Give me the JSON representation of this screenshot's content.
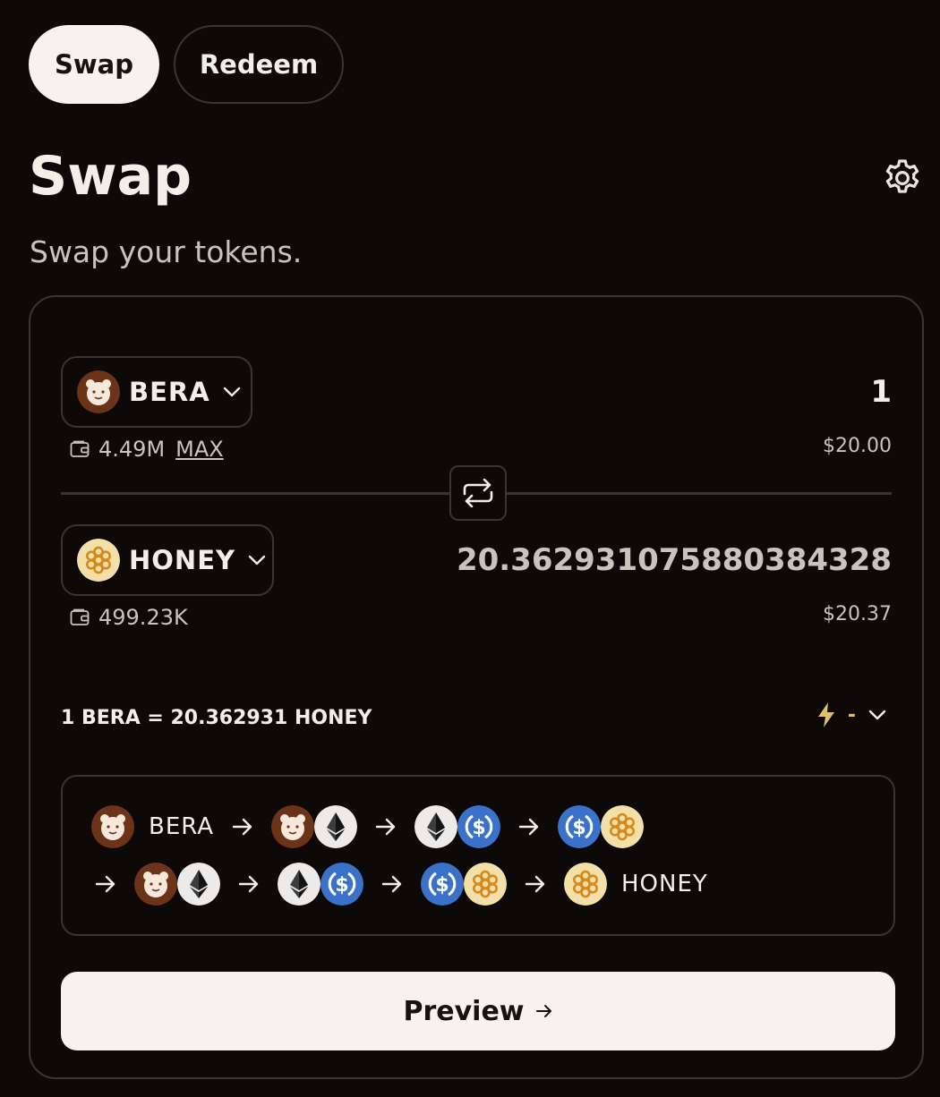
{
  "tabs": [
    {
      "label": "Swap",
      "active": true
    },
    {
      "label": "Redeem",
      "active": false
    }
  ],
  "header": {
    "title": "Swap",
    "subtitle": "Swap your tokens.",
    "settings_icon": "gear-icon"
  },
  "from": {
    "token": "BERA",
    "icon": "bera-icon",
    "balance": "4.49M",
    "max_label": "MAX",
    "amount": "1",
    "usd_value": "$20.00"
  },
  "to": {
    "token": "HONEY",
    "icon": "honey-icon",
    "balance": "499.23K",
    "amount": "20.362931075880384328",
    "usd_value": "$20.37"
  },
  "rate": "1 BERA = 20.362931 HONEY",
  "speed": {
    "icon": "lightning-icon",
    "value": "-"
  },
  "route": {
    "start_label": "BERA",
    "end_label": "HONEY",
    "hops": [
      [
        "bera",
        "eth"
      ],
      [
        "eth",
        "usdc"
      ],
      [
        "usdc",
        "honey"
      ],
      [
        "bera",
        "eth"
      ],
      [
        "eth",
        "usdc"
      ],
      [
        "usdc",
        "honey"
      ]
    ]
  },
  "preview_label": "Preview",
  "colors": {
    "background": "#0c0908",
    "border": "#3a3532",
    "button_light": "#f5f3ef",
    "accent_gold": "#e2be6d",
    "bera_brown": "#6b3418",
    "usdc_blue": "#3a72c9",
    "honey_yellow": "#f3dfa8"
  }
}
